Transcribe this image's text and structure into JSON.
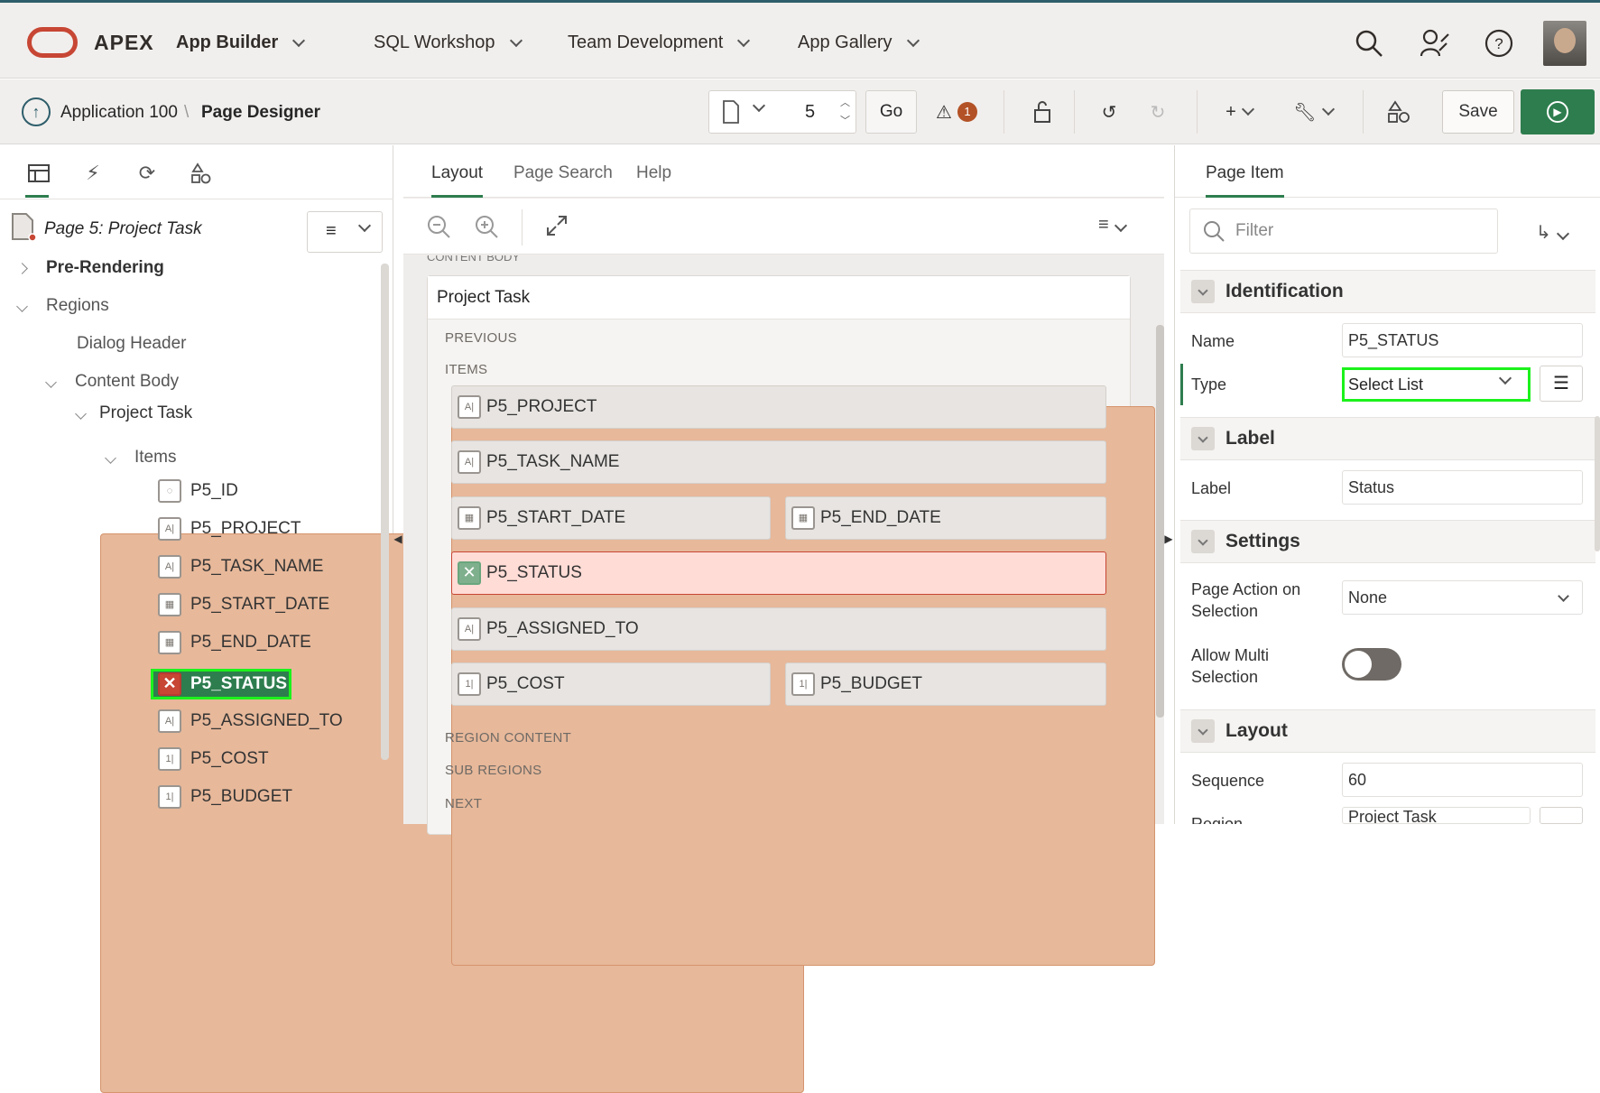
{
  "header": {
    "product": "APEX",
    "nav": [
      {
        "label": "App Builder"
      },
      {
        "label": "SQL Workshop"
      },
      {
        "label": "Team Development"
      },
      {
        "label": "App Gallery"
      }
    ]
  },
  "toolbar": {
    "breadcrumb_app": "Application 100",
    "breadcrumb_sep": "\\",
    "breadcrumb_page": "Page Designer",
    "page_number": "5",
    "go_label": "Go",
    "issues_count": "1",
    "save_label": "Save"
  },
  "left": {
    "page_title": "Page 5: Project Task",
    "tree": [
      {
        "label": "Pre-Rendering"
      },
      {
        "label": "Regions"
      },
      {
        "label": "Dialog Header"
      },
      {
        "label": "Content Body"
      },
      {
        "label": "Project Task"
      },
      {
        "label": "Items"
      },
      {
        "label": "P5_ID"
      },
      {
        "label": "P5_PROJECT"
      },
      {
        "label": "P5_TASK_NAME"
      },
      {
        "label": "P5_START_DATE"
      },
      {
        "label": "P5_END_DATE"
      },
      {
        "label": "P5_STATUS"
      },
      {
        "label": "P5_ASSIGNED_TO"
      },
      {
        "label": "P5_COST"
      },
      {
        "label": "P5_BUDGET"
      }
    ]
  },
  "center": {
    "tabs": [
      "Layout",
      "Page Search",
      "Help"
    ],
    "content_body_label": "CONTENT BODY",
    "region_title": "Project Task",
    "sections": {
      "previous": "PREVIOUS",
      "items": "ITEMS",
      "region_content": "REGION CONTENT",
      "sub_regions": "SUB REGIONS",
      "next": "NEXT"
    },
    "items": [
      {
        "label": "P5_PROJECT"
      },
      {
        "label": "P5_TASK_NAME"
      },
      {
        "label": "P5_START_DATE"
      },
      {
        "label": "P5_END_DATE"
      },
      {
        "label": "P5_STATUS"
      },
      {
        "label": "P5_ASSIGNED_TO"
      },
      {
        "label": "P5_COST"
      },
      {
        "label": "P5_BUDGET"
      }
    ]
  },
  "right": {
    "tab": "Page Item",
    "filter_placeholder": "Filter",
    "groups": {
      "identification": "Identification",
      "label": "Label",
      "settings": "Settings",
      "layout": "Layout"
    },
    "props": {
      "name_label": "Name",
      "name_value": "P5_STATUS",
      "type_label": "Type",
      "type_value": "Select List",
      "label_label": "Label",
      "label_value": "Status",
      "page_action_label": "Page Action on Selection",
      "page_action_value": "None",
      "allow_multi_label": "Allow Multi Selection",
      "sequence_label": "Sequence",
      "sequence_value": "60",
      "region_label": "Region",
      "region_value": "Project Task"
    }
  },
  "colors": {
    "accent": "#2e7d4e",
    "brand": "#c74634",
    "highlight": "#1cf21c"
  }
}
